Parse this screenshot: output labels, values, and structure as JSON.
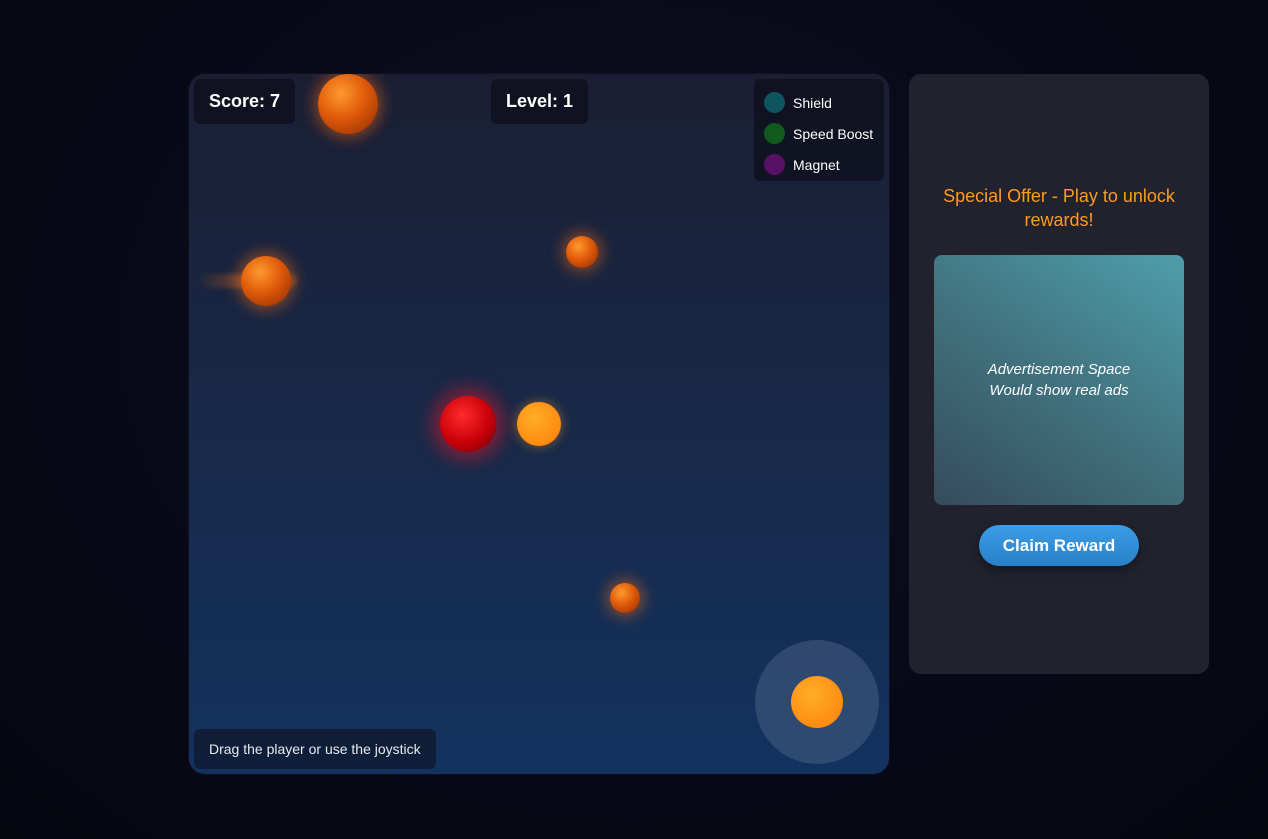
{
  "hud": {
    "score": "Score: 7",
    "level": "Level: 1"
  },
  "powerups": [
    {
      "label": "Shield",
      "color": "#0f5560"
    },
    {
      "label": "Speed Boost",
      "color": "#0f5a1c"
    },
    {
      "label": "Magnet",
      "color": "#571063"
    }
  ],
  "hint": "Drag the player or use the joystick",
  "sidebar": {
    "offer_text": "Special Offer - Play to unlock rewards!",
    "ad_line1": "Advertisement Space",
    "ad_line2": "Would show real ads",
    "claim_label": "Claim Reward"
  },
  "colors": {
    "accent_orange": "#ff9a1f",
    "button_blue": "#3a9de6",
    "player_red": "#e00010",
    "coin_orange": "#ff8a10"
  }
}
